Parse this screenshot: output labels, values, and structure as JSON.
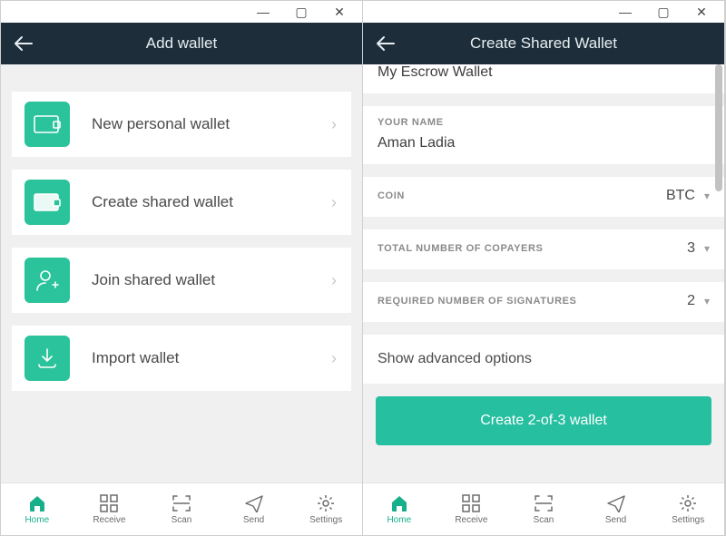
{
  "left": {
    "title": "Add wallet",
    "options": [
      {
        "label": "New personal wallet"
      },
      {
        "label": "Create shared wallet"
      },
      {
        "label": "Join shared wallet"
      },
      {
        "label": "Import wallet"
      }
    ]
  },
  "right": {
    "title": "Create Shared Wallet",
    "wallet_name": "My Escrow Wallet",
    "your_name_label": "YOUR NAME",
    "your_name": "Aman Ladia",
    "coin_label": "COIN",
    "coin": "BTC",
    "copayers_label": "TOTAL NUMBER OF COPAYERS",
    "copayers": "3",
    "sigs_label": "REQUIRED NUMBER OF SIGNATURES",
    "sigs": "2",
    "advanced": "Show advanced options",
    "create_button": "Create 2-of-3 wallet"
  },
  "nav": {
    "home": "Home",
    "receive": "Receive",
    "scan": "Scan",
    "send": "Send",
    "settings": "Settings"
  },
  "colors": {
    "accent": "#2ac39b",
    "header": "#1d2e3a"
  }
}
